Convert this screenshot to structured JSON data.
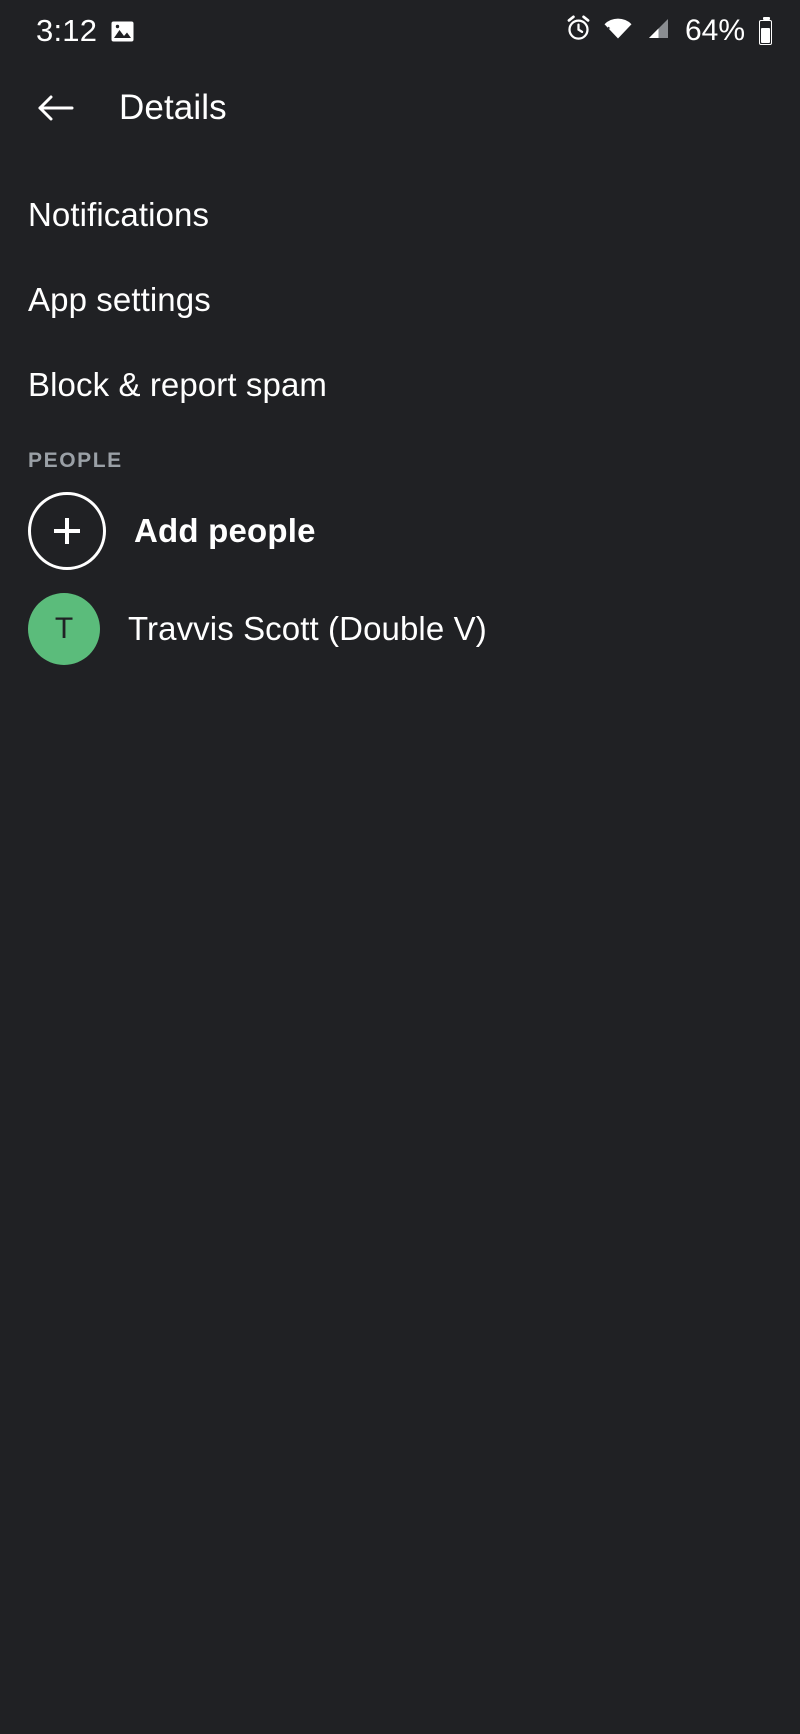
{
  "status_bar": {
    "time": "3:12",
    "battery_percent": "64%",
    "icons": {
      "photo": "photo-icon",
      "alarm": "alarm-clock-icon",
      "wifi": "wifi-icon",
      "signal": "cellular-signal-icon",
      "battery": "battery-icon"
    }
  },
  "toolbar": {
    "back_icon": "back-arrow-icon",
    "title": "Details"
  },
  "menu": {
    "items": [
      {
        "label": "Notifications"
      },
      {
        "label": "App settings"
      },
      {
        "label": "Block & report spam"
      }
    ]
  },
  "people": {
    "section_label": "PEOPLE",
    "add_people_label": "Add people",
    "add_icon": "plus-circle-icon",
    "contacts": [
      {
        "name": "Travvis Scott (Double V)",
        "initial": "T",
        "avatar_color": "#5BBC7B"
      }
    ]
  },
  "colors": {
    "background": "#202124",
    "primary_text": "#ffffff",
    "secondary_text": "#9aa0a6",
    "avatar_green": "#5BBC7B"
  }
}
